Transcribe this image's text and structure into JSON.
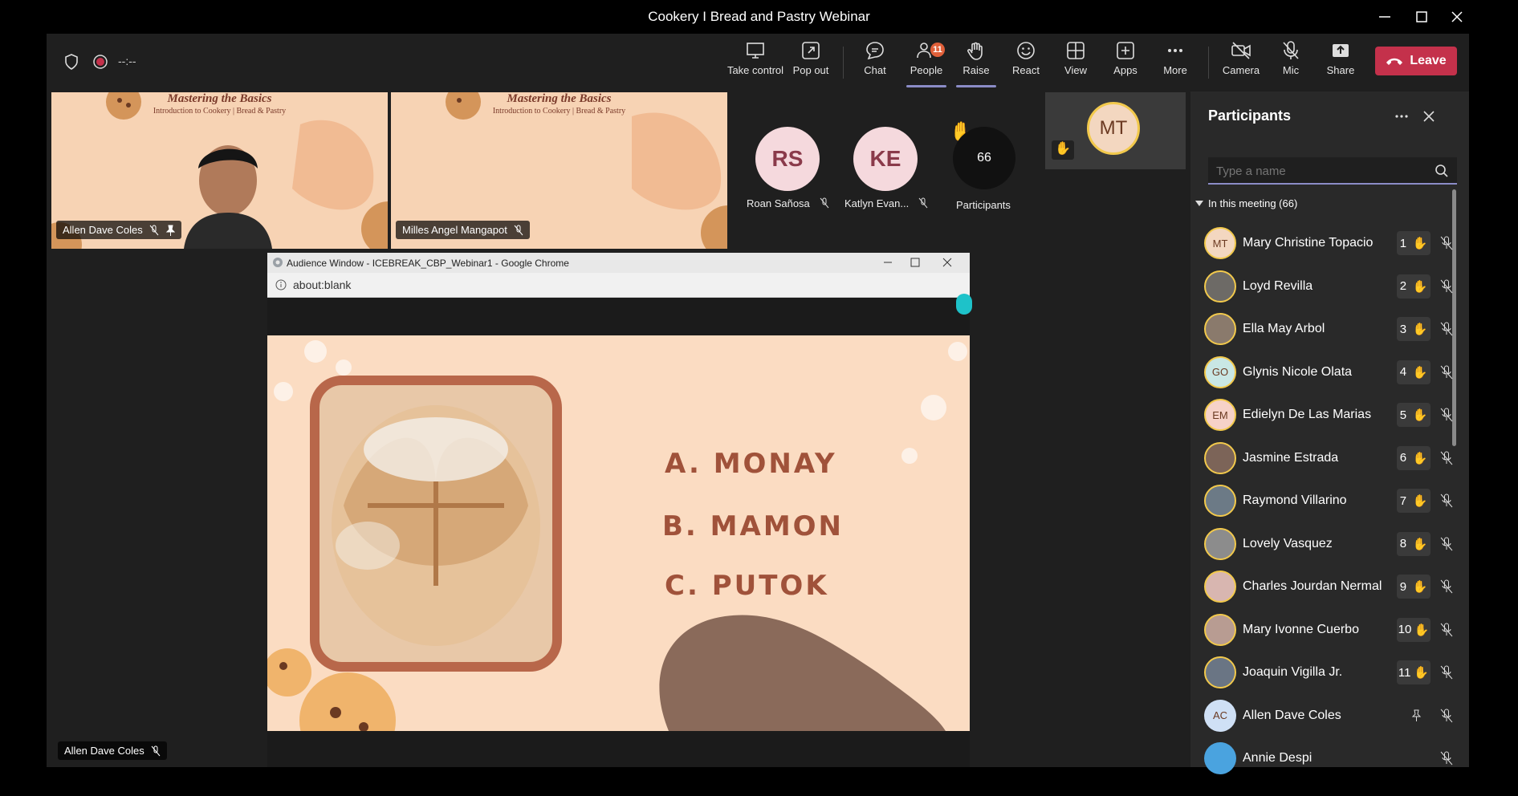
{
  "window": {
    "title": "Cookery I Bread and Pastry Webinar"
  },
  "meeting": {
    "timer": "--:--"
  },
  "toolbar": {
    "take_control": "Take control",
    "pop_out": "Pop out",
    "chat": "Chat",
    "people": "People",
    "people_badge": "11",
    "raise": "Raise",
    "react": "React",
    "view": "View",
    "apps": "Apps",
    "more": "More",
    "camera": "Camera",
    "mic": "Mic",
    "share": "Share",
    "leave": "Leave"
  },
  "tiles": {
    "banner_title": "Mastering the Basics",
    "banner_sub": "Introduction to Cookery | Bread & Pastry",
    "tile1_name": "Allen Dave Coles",
    "tile2_name": "Milles Angel Mangapot",
    "rs_initials": "RS",
    "rs_name": "Roan Sañosa",
    "ke_initials": "KE",
    "ke_name": "Katlyn Evan...",
    "count": "66",
    "count_label": "Participants",
    "mt_initials": "MT",
    "bottom_name": "Allen Dave Coles"
  },
  "chrome": {
    "title": "Audience Window - ICEBREAK_CBP_Webinar1 - Google Chrome",
    "url": "about:blank"
  },
  "slide": {
    "option_a": "A. MONAY",
    "option_b": "B. MAMON",
    "option_c": "C. PUTOK"
  },
  "panel": {
    "title": "Participants",
    "search_placeholder": "Type a name",
    "section": "In this meeting (66)",
    "participants": [
      {
        "name": "Mary Christine Topacio",
        "initials": "MT",
        "hand": "1",
        "color": "#f3d7c0"
      },
      {
        "name": "Loyd Revilla",
        "initials": "",
        "hand": "2",
        "color": "#6d6a66"
      },
      {
        "name": "Ella May Arbol",
        "initials": "",
        "hand": "3",
        "color": "#8a7a6c"
      },
      {
        "name": "Glynis Nicole Olata",
        "initials": "GO",
        "hand": "4",
        "color": "#c9e7e5"
      },
      {
        "name": "Edielyn De Las Marias",
        "initials": "EM",
        "hand": "5",
        "color": "#f6d2c8"
      },
      {
        "name": "Jasmine Estrada",
        "initials": "",
        "hand": "6",
        "color": "#7c6458"
      },
      {
        "name": "Raymond Villarino",
        "initials": "",
        "hand": "7",
        "color": "#6c7a86"
      },
      {
        "name": "Lovely Vasquez",
        "initials": "",
        "hand": "8",
        "color": "#8c8c8c"
      },
      {
        "name": "Charles Jourdan Nermal",
        "initials": "",
        "hand": "9",
        "color": "#d8b6b0"
      },
      {
        "name": "Mary Ivonne Cuerbo",
        "initials": "",
        "hand": "10",
        "color": "#b89c92"
      },
      {
        "name": "Joaquin Vigilla Jr.",
        "initials": "",
        "hand": "11",
        "color": "#6a7584"
      },
      {
        "name": "Allen Dave Coles",
        "initials": "AC",
        "hand": "",
        "color": "#cfe0f5"
      },
      {
        "name": "Annie Despi",
        "initials": "",
        "hand": "",
        "color": "#4aa3df"
      }
    ]
  }
}
